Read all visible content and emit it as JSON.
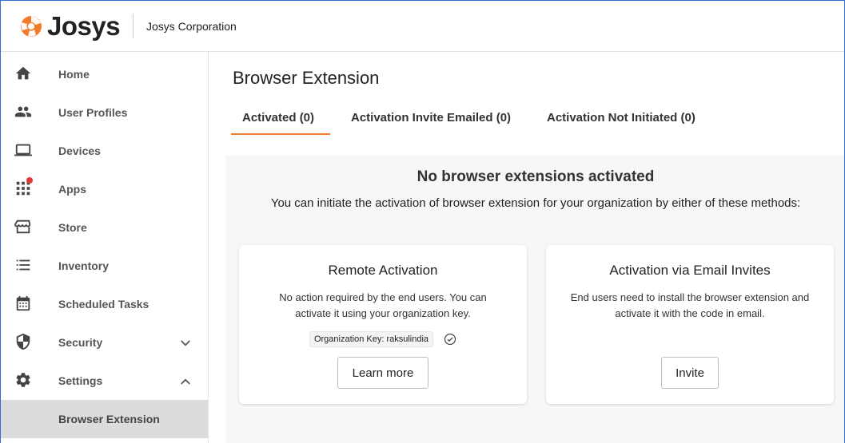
{
  "header": {
    "brand": "Josys",
    "org_name": "Josys Corporation",
    "brand_color": "#f07b2a"
  },
  "sidebar": {
    "items": [
      {
        "label": "Home",
        "icon": "home-icon"
      },
      {
        "label": "User Profiles",
        "icon": "people-icon"
      },
      {
        "label": "Devices",
        "icon": "laptop-icon"
      },
      {
        "label": "Apps",
        "icon": "grid-icon",
        "badge": true
      },
      {
        "label": "Store",
        "icon": "store-icon"
      },
      {
        "label": "Inventory",
        "icon": "list-icon"
      },
      {
        "label": "Scheduled Tasks",
        "icon": "calendar-icon"
      },
      {
        "label": "Security",
        "icon": "shield-icon",
        "expand": "chevron-down-icon"
      },
      {
        "label": "Settings",
        "icon": "gear-icon",
        "expand": "chevron-up-icon"
      },
      {
        "label": "Browser Extension",
        "active": true
      }
    ]
  },
  "main": {
    "title": "Browser Extension",
    "tabs": [
      {
        "label": "Activated (0)",
        "active": true
      },
      {
        "label": "Activation Invite Emailed (0)"
      },
      {
        "label": "Activation Not Initiated (0)"
      }
    ],
    "empty_title": "No browser extensions activated",
    "empty_subtitle": "You can initiate the activation of browser extension for your organization by either of these methods:",
    "cards": [
      {
        "title": "Remote Activation",
        "text": "No action required by the end users. You can activate it using your organization key.",
        "key_label": "Organization Key: raksulindia",
        "button": "Learn more"
      },
      {
        "title": "Activation via Email Invites",
        "text": "End users need to install the browser extension and activate it with the code in email.",
        "button": "Invite"
      }
    ]
  }
}
